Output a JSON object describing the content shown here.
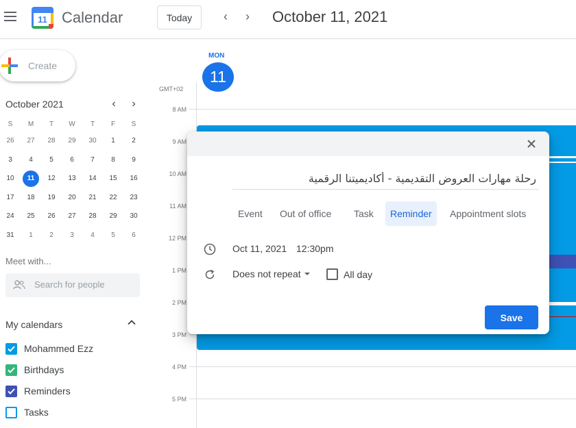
{
  "header": {
    "app_title": "Calendar",
    "logo_day": "11",
    "today_label": "Today",
    "prev_icon": "‹",
    "next_icon": "›",
    "date_title": "October 11, 2021"
  },
  "sidebar": {
    "create_label": "Create",
    "mini_calendar": {
      "month_title": "October 2021",
      "weekday_headers": [
        "S",
        "M",
        "T",
        "W",
        "T",
        "F",
        "S"
      ],
      "weeks": [
        [
          "26",
          "27",
          "28",
          "29",
          "30",
          "1",
          "2"
        ],
        [
          "3",
          "4",
          "5",
          "6",
          "7",
          "8",
          "9"
        ],
        [
          "10",
          "11",
          "12",
          "13",
          "14",
          "15",
          "16"
        ],
        [
          "17",
          "18",
          "19",
          "20",
          "21",
          "22",
          "23"
        ],
        [
          "24",
          "25",
          "26",
          "27",
          "28",
          "29",
          "30"
        ],
        [
          "31",
          "1",
          "2",
          "3",
          "4",
          "5",
          "6"
        ]
      ],
      "selected_day": "11"
    },
    "meet_title": "Meet with...",
    "people_placeholder": "Search for people",
    "my_calendars_title": "My calendars",
    "calendars": [
      {
        "label": "Mohammed Ezz",
        "color": "#039be5",
        "checked": true
      },
      {
        "label": "Birthdays",
        "color": "#33b679",
        "checked": true
      },
      {
        "label": "Reminders",
        "color": "#3f51b5",
        "checked": true
      },
      {
        "label": "Tasks",
        "color": "#039be5",
        "checked": false
      }
    ]
  },
  "day_view": {
    "day_of_week": "MON",
    "day_number": "11",
    "timezone": "GMT+02",
    "hours": [
      "8 AM",
      "9 AM",
      "10 AM",
      "11 AM",
      "12 PM",
      "1 PM",
      "2 PM",
      "3 PM",
      "4 PM",
      "5 PM"
    ]
  },
  "dialog": {
    "title_value": "رحلة مهارات العروض التقديمية - أكاديميتنا الرقمية",
    "tabs": [
      "Event",
      "Out of office",
      "Task",
      "Reminder",
      "Appointment slots"
    ],
    "active_tab": "Reminder",
    "date": "Oct 11, 2021",
    "time": "12:30pm",
    "repeat": "Does not repeat",
    "all_day_label": "All day",
    "all_day_checked": false,
    "save_label": "Save"
  },
  "colors": {
    "accent": "#1a73e8",
    "event": "#039be5",
    "reminders": "#3f51b5",
    "birthdays": "#33b679"
  }
}
